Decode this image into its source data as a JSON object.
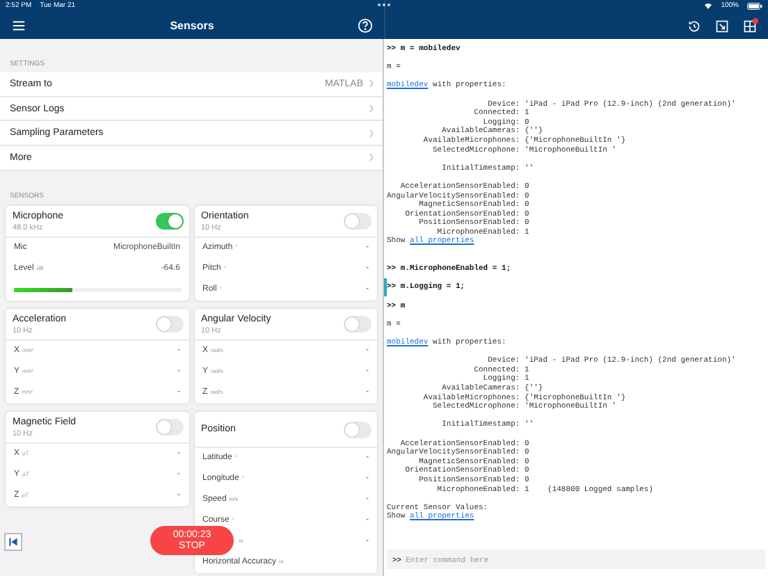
{
  "status_bar": {
    "time": "2:52 PM",
    "date": "Tue Mar 21",
    "battery": "100%"
  },
  "sensors_pane": {
    "title": "Sensors",
    "settings_label": "SETTINGS",
    "settings": [
      {
        "label": "Stream to",
        "value": "MATLAB"
      },
      {
        "label": "Sensor Logs"
      },
      {
        "label": "Sampling Parameters"
      },
      {
        "label": "More"
      }
    ],
    "sensors_label": "SENSORS",
    "columns": [
      [
        {
          "name": "Microphone",
          "rate": "48.0 kHz",
          "on": true,
          "rows": [
            {
              "kind": "reading",
              "label": "Mic",
              "value": "MicrophoneBuiltIn"
            },
            {
              "kind": "reading",
              "label": "Level",
              "unit": "dB",
              "value": "-64.6"
            },
            {
              "kind": "meter",
              "level": 0.35
            }
          ]
        },
        {
          "name": "Acceleration",
          "rate": "10 Hz",
          "on": false,
          "rows": [
            {
              "kind": "reading",
              "label": "X",
              "unit": "m/s²",
              "value": "-"
            },
            {
              "kind": "reading",
              "label": "Y",
              "unit": "m/s²",
              "value": "-"
            },
            {
              "kind": "reading",
              "label": "Z",
              "unit": "m/s²",
              "value": "-"
            }
          ]
        },
        {
          "name": "Magnetic Field",
          "rate": "10 Hz",
          "on": false,
          "rows": [
            {
              "kind": "reading",
              "label": "X",
              "unit": "µT",
              "value": "-"
            },
            {
              "kind": "reading",
              "label": "Y",
              "unit": "µT",
              "value": "-"
            },
            {
              "kind": "reading",
              "label": "Z",
              "unit": "µT",
              "value": "-"
            }
          ]
        }
      ],
      [
        {
          "name": "Orientation",
          "rate": "10 Hz",
          "on": false,
          "rows": [
            {
              "kind": "reading",
              "label": "Azimuth",
              "unit": "°",
              "value": "-"
            },
            {
              "kind": "reading",
              "label": "Pitch",
              "unit": "°",
              "value": "-"
            },
            {
              "kind": "reading",
              "label": "Roll",
              "unit": "°",
              "value": "-"
            }
          ]
        },
        {
          "name": "Angular Velocity",
          "rate": "10 Hz",
          "on": false,
          "rows": [
            {
              "kind": "reading",
              "label": "X",
              "unit": "rad/s",
              "value": "-"
            },
            {
              "kind": "reading",
              "label": "Y",
              "unit": "rad/s",
              "value": "-"
            },
            {
              "kind": "reading",
              "label": "Z",
              "unit": "rad/s",
              "value": "-"
            }
          ]
        },
        {
          "name": "Position",
          "on": false,
          "rows": [
            {
              "kind": "reading",
              "label": "Latitude",
              "unit": "°",
              "value": "-"
            },
            {
              "kind": "reading",
              "label": "Longitude",
              "unit": "°",
              "value": "-"
            },
            {
              "kind": "reading",
              "label": "Speed",
              "unit": "m/s",
              "value": "-"
            },
            {
              "kind": "reading",
              "label": "Course",
              "unit": "°",
              "value": "-"
            },
            {
              "kind": "reading",
              "unit": "m",
              "value": "-"
            },
            {
              "kind": "reading",
              "label": "Horizontal Accuracy",
              "unit": "m"
            }
          ]
        }
      ]
    ],
    "timer": {
      "time": "00:00:23",
      "label": "STOP"
    }
  },
  "console": {
    "lines": [
      {
        "kind": "cmd",
        "text": ">> m = mobiledev",
        "marked": false
      },
      {
        "kind": "blank"
      },
      {
        "kind": "out",
        "text": "m ="
      },
      {
        "kind": "blank"
      },
      {
        "kind": "link",
        "link": "mobiledev",
        "after": " with properties:"
      },
      {
        "kind": "blank"
      },
      {
        "kind": "prop",
        "name": "Device:",
        "value": "'iPad - iPad Pro (12.9-inch) (2nd generation)'"
      },
      {
        "kind": "prop",
        "name": "Connected:",
        "value": "1"
      },
      {
        "kind": "prop",
        "name": "Logging:",
        "value": "0"
      },
      {
        "kind": "prop",
        "name": "AvailableCameras:",
        "value": "{''}"
      },
      {
        "kind": "prop",
        "name": "AvailableMicrophones:",
        "value": "{'MicrophoneBuiltIn '}"
      },
      {
        "kind": "prop",
        "name": "SelectedMicrophone:",
        "value": "'MicrophoneBuiltIn '"
      },
      {
        "kind": "blank"
      },
      {
        "kind": "prop",
        "name": "InitialTimestamp:",
        "value": "''"
      },
      {
        "kind": "blank"
      },
      {
        "kind": "prop",
        "name": "AccelerationSensorEnabled:",
        "value": "0"
      },
      {
        "kind": "prop",
        "name": "AngularVelocitySensorEnabled:",
        "value": "0"
      },
      {
        "kind": "prop",
        "name": "MagneticSensorEnabled:",
        "value": "0"
      },
      {
        "kind": "prop",
        "name": "OrientationSensorEnabled:",
        "value": "0"
      },
      {
        "kind": "prop",
        "name": "PositionSensorEnabled:",
        "value": "0"
      },
      {
        "kind": "prop",
        "name": "MicrophoneEnabled:",
        "value": "1"
      },
      {
        "kind": "link",
        "before": "Show ",
        "link": "all properties"
      },
      {
        "kind": "blank"
      },
      {
        "kind": "blank"
      },
      {
        "kind": "cmd",
        "text": ">> m.MicrophoneEnabled = 1;",
        "marked": false
      },
      {
        "kind": "blank"
      },
      {
        "kind": "cmd",
        "text": ">> m.Logging = 1;",
        "marked": true
      },
      {
        "kind": "blank"
      },
      {
        "kind": "cmd",
        "text": ">> m",
        "marked": false
      },
      {
        "kind": "blank"
      },
      {
        "kind": "out",
        "text": "m ="
      },
      {
        "kind": "blank"
      },
      {
        "kind": "link",
        "link": "mobiledev",
        "after": " with properties:"
      },
      {
        "kind": "blank"
      },
      {
        "kind": "prop",
        "name": "Device:",
        "value": "'iPad - iPad Pro (12.9-inch) (2nd generation)'"
      },
      {
        "kind": "prop",
        "name": "Connected:",
        "value": "1"
      },
      {
        "kind": "prop",
        "name": "Logging:",
        "value": "1"
      },
      {
        "kind": "prop",
        "name": "AvailableCameras:",
        "value": "{''}"
      },
      {
        "kind": "prop",
        "name": "AvailableMicrophones:",
        "value": "{'MicrophoneBuiltIn '}"
      },
      {
        "kind": "prop",
        "name": "SelectedMicrophone:",
        "value": "'MicrophoneBuiltIn '"
      },
      {
        "kind": "blank"
      },
      {
        "kind": "prop",
        "name": "InitialTimestamp:",
        "value": "''"
      },
      {
        "kind": "blank"
      },
      {
        "kind": "prop",
        "name": "AccelerationSensorEnabled:",
        "value": "0"
      },
      {
        "kind": "prop",
        "name": "AngularVelocitySensorEnabled:",
        "value": "0"
      },
      {
        "kind": "prop",
        "name": "MagneticSensorEnabled:",
        "value": "0"
      },
      {
        "kind": "prop",
        "name": "OrientationSensorEnabled:",
        "value": "0"
      },
      {
        "kind": "prop",
        "name": "PositionSensorEnabled:",
        "value": "0"
      },
      {
        "kind": "prop",
        "name": "MicrophoneEnabled:",
        "value": "1    (148800 Logged samples)"
      },
      {
        "kind": "blank"
      },
      {
        "kind": "out",
        "text": "Current Sensor Values:"
      },
      {
        "kind": "link",
        "before": "Show ",
        "link": "all properties"
      }
    ],
    "prompt": {
      "mark": ">>",
      "placeholder": "Enter command here"
    }
  }
}
